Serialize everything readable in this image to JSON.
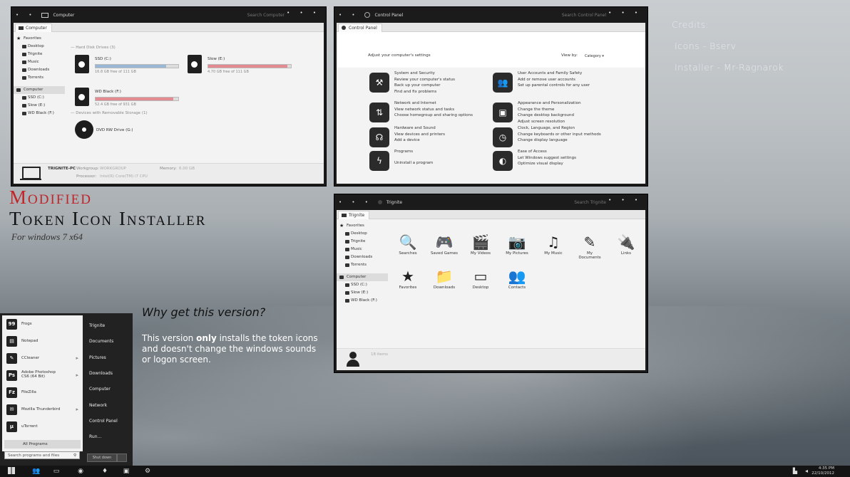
{
  "credits": {
    "title": "Credits:",
    "icons": "Icons - Bserv",
    "installer": "Installer - Mr-Ragnarok"
  },
  "headline": {
    "line1": "Modified",
    "line2": "Token Icon Installer",
    "line3": "For windows 7 x64"
  },
  "why": "Why get this version?",
  "desc": {
    "pre": "This version ",
    "bold": "only",
    "post": " installs the token icons and doesn't change the windows sounds or logon screen."
  },
  "computer": {
    "title": "Computer",
    "search": "Search Computer",
    "tab": "Computer",
    "sidebar": [
      "Favorites",
      "Desktop",
      "Trignite",
      "Music",
      "Downloads",
      "Torrents",
      "Computer",
      "SSD (C:)",
      "Slow (E:)",
      "WD Black (F:)"
    ],
    "hdd_header": "Hard Disk Drives (3)",
    "drives": [
      {
        "name": "SSD (C:)",
        "free": "16.8 GB free of 111 GB",
        "used": 0.85,
        "color": "#9ab8d6"
      },
      {
        "name": "Slow (E:)",
        "free": "4.70 GB free of 111 GB",
        "used": 0.96,
        "color": "#e38b90"
      },
      {
        "name": "WD Black (F:)",
        "free": "52.4 GB free of 931 GB",
        "used": 0.94,
        "color": "#e38b90"
      }
    ],
    "removable_header": "Devices with Removable Storage (1)",
    "dvd": "DVD RW Drive (G:)",
    "details": {
      "pcname": "TRIGNITE-PC",
      "workgroup_label": "Workgroup:",
      "workgroup": "WORKGROUP",
      "memory_label": "Memory:",
      "memory": "6.00 GB",
      "processor_label": "Processor:",
      "processor": "Intel(R) Core(TM) i7 CPU"
    }
  },
  "control": {
    "title": "Control Panel",
    "search": "Search Control Panel",
    "tab": "Control Panel",
    "heading": "Adjust your computer's settings",
    "viewby": "View by:",
    "category": "Category",
    "left": [
      {
        "icon": "wrench-icon",
        "glyph": "⚒",
        "lines": [
          "System and Security",
          "Review your computer's status",
          "Back up your computer",
          "Find and fix problems"
        ]
      },
      {
        "icon": "network-icon",
        "glyph": "⇅",
        "lines": [
          "Network and Internet",
          "View network status and tasks",
          "Choose homegroup and sharing options"
        ]
      },
      {
        "icon": "headphones-icon",
        "glyph": "☊",
        "lines": [
          "Hardware and Sound",
          "View devices and printers",
          "Add a device"
        ]
      },
      {
        "icon": "lightning-icon",
        "glyph": "ϟ",
        "lines": [
          "Programs",
          "Uninstall a program"
        ]
      }
    ],
    "right": [
      {
        "icon": "users-icon",
        "glyph": "👥",
        "lines": [
          "User Accounts and Family Safety",
          "Add or remove user accounts",
          "Set up parental controls for any user"
        ]
      },
      {
        "icon": "appearance-icon",
        "glyph": "▣",
        "lines": [
          "Appearance and Personalization",
          "Change the theme",
          "Change desktop background",
          "Adjust screen resolution"
        ]
      },
      {
        "icon": "clock-icon",
        "glyph": "◷",
        "lines": [
          "Clock, Language, and Region",
          "Change keyboards or other input methods",
          "Change display language"
        ]
      },
      {
        "icon": "ease-icon",
        "glyph": "◐",
        "lines": [
          "Ease of Access",
          "Let Windows suggest settings",
          "Optimize visual display"
        ]
      }
    ]
  },
  "trignite": {
    "title": "Trignite",
    "search": "Search Trignite",
    "tab": "Trignite",
    "sidebar": [
      "Favorites",
      "Desktop",
      "Trignite",
      "Music",
      "Downloads",
      "Torrents",
      "Computer",
      "SSD (C:)",
      "Slow (E:)",
      "WD Black (F:)"
    ],
    "icons": [
      {
        "label": "Searches",
        "glyph": "🔍",
        "icon": "searches-icon"
      },
      {
        "label": "Saved Games",
        "glyph": "🎮",
        "icon": "gamepad-icon"
      },
      {
        "label": "My Videos",
        "glyph": "🎬",
        "icon": "clapper-icon"
      },
      {
        "label": "My Pictures",
        "glyph": "📷",
        "icon": "camera-icon"
      },
      {
        "label": "My Music",
        "glyph": "♫",
        "icon": "music-icon"
      },
      {
        "label": "My Documents",
        "glyph": "✎",
        "icon": "documents-icon"
      },
      {
        "label": "Links",
        "glyph": "🔌",
        "icon": "links-icon"
      },
      {
        "label": "Favorites",
        "glyph": "★",
        "icon": "star-icon"
      },
      {
        "label": "Downloads",
        "glyph": "📁",
        "icon": "downloads-folder-icon"
      },
      {
        "label": "Desktop",
        "glyph": "▭",
        "icon": "desktop-icon"
      },
      {
        "label": "Contacts",
        "glyph": "👥",
        "icon": "contacts-icon"
      }
    ],
    "status": "18 items"
  },
  "startmenu": {
    "items": [
      {
        "label": "Frogs",
        "badge": "99",
        "arrow": ""
      },
      {
        "label": "Notepad",
        "badge": "▤",
        "arrow": ""
      },
      {
        "label": "CCleaner",
        "badge": "✎",
        "arrow": "▸"
      },
      {
        "label": "Adobe Photoshop CS6 (64 Bit)",
        "badge": "Ps",
        "arrow": "▸"
      },
      {
        "label": "FileZilla",
        "badge": "Fz",
        "arrow": ""
      },
      {
        "label": "Mozilla Thunderbird",
        "badge": "✉",
        "arrow": "▸"
      },
      {
        "label": "uTorrent",
        "badge": "µ",
        "arrow": ""
      }
    ],
    "right": [
      "Trignite",
      "Documents",
      "Pictures",
      "Downloads",
      "Computer",
      "Network",
      "Control Panel",
      "Run..."
    ],
    "all_programs": "All Programs",
    "search": "Search programs and files",
    "shutdown": "Shut down"
  },
  "taskbar": {
    "time": "4:35 PM",
    "date": "22/10/2012"
  }
}
